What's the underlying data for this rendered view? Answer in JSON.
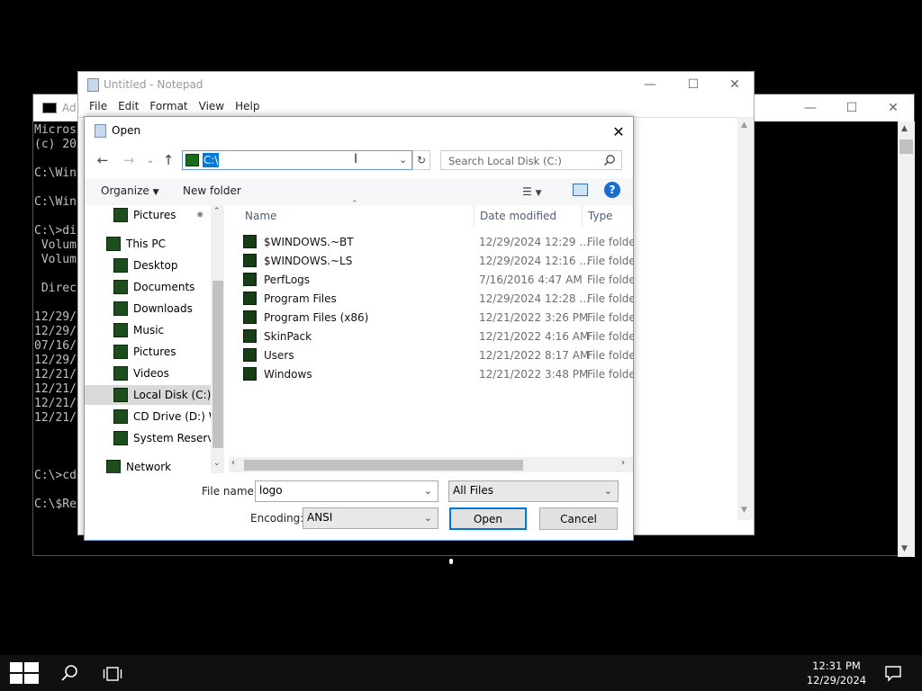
{
  "cmd": {
    "title": "Ad",
    "lines": [
      "Micros",
      "(c) 20",
      "",
      "C:\\Win",
      "",
      "C:\\Win",
      "",
      "C:\\>di",
      " Volum",
      " Volum",
      "",
      " Direc",
      "",
      "12/29/",
      "12/29/",
      "07/16/",
      "12/29/",
      "12/21/",
      "12/21/",
      "12/21/",
      "12/21/",
      "",
      "",
      "",
      "C:\\>cd",
      "",
      "C:\\$Re"
    ]
  },
  "notepad": {
    "title": "Untitled - Notepad",
    "menu": [
      "File",
      "Edit",
      "Format",
      "View",
      "Help"
    ]
  },
  "dialog": {
    "title": "Open",
    "address": "C:\\",
    "search_placeholder": "Search Local Disk (C:)",
    "organize": "Organize",
    "new_folder": "New folder",
    "nav": [
      {
        "label": "Pictures",
        "indent": 1,
        "pinned": true
      },
      {
        "label": "This PC",
        "indent": 0
      },
      {
        "label": "Desktop",
        "indent": 1
      },
      {
        "label": "Documents",
        "indent": 1
      },
      {
        "label": "Downloads",
        "indent": 1
      },
      {
        "label": "Music",
        "indent": 1
      },
      {
        "label": "Pictures",
        "indent": 1
      },
      {
        "label": "Videos",
        "indent": 1
      },
      {
        "label": "Local Disk (C:)",
        "indent": 1,
        "selected": true
      },
      {
        "label": "CD Drive (D:) Wi",
        "indent": 1
      },
      {
        "label": "System Reservec",
        "indent": 1
      },
      {
        "label": "Network",
        "indent": 0
      }
    ],
    "columns": {
      "name": "Name",
      "date": "Date modified",
      "type": "Type"
    },
    "files": [
      {
        "name": "$WINDOWS.~BT",
        "date": "12/29/2024 12:29 ...",
        "type": "File folder"
      },
      {
        "name": "$WINDOWS.~LS",
        "date": "12/29/2024 12:16 ...",
        "type": "File folder"
      },
      {
        "name": "PerfLogs",
        "date": "7/16/2016 4:47 AM",
        "type": "File folder"
      },
      {
        "name": "Program Files",
        "date": "12/29/2024 12:28 ...",
        "type": "File folder"
      },
      {
        "name": "Program Files (x86)",
        "date": "12/21/2022 3:26 PM",
        "type": "File folder"
      },
      {
        "name": "SkinPack",
        "date": "12/21/2022 4:16 AM",
        "type": "File folder"
      },
      {
        "name": "Users",
        "date": "12/21/2022 8:17 AM",
        "type": "File folder"
      },
      {
        "name": "Windows",
        "date": "12/21/2022 3:48 PM",
        "type": "File folder"
      }
    ],
    "file_name_label": "File name:",
    "file_name_value": "logo",
    "file_type": "All Files",
    "encoding_label": "Encoding:",
    "encoding": "ANSI",
    "open_label": "Open",
    "cancel_label": "Cancel"
  },
  "taskbar": {
    "time": "12:31 PM",
    "date": "12/29/2024"
  },
  "colors": {
    "accent": "#0078d7",
    "folder_icon": "#173d17"
  }
}
